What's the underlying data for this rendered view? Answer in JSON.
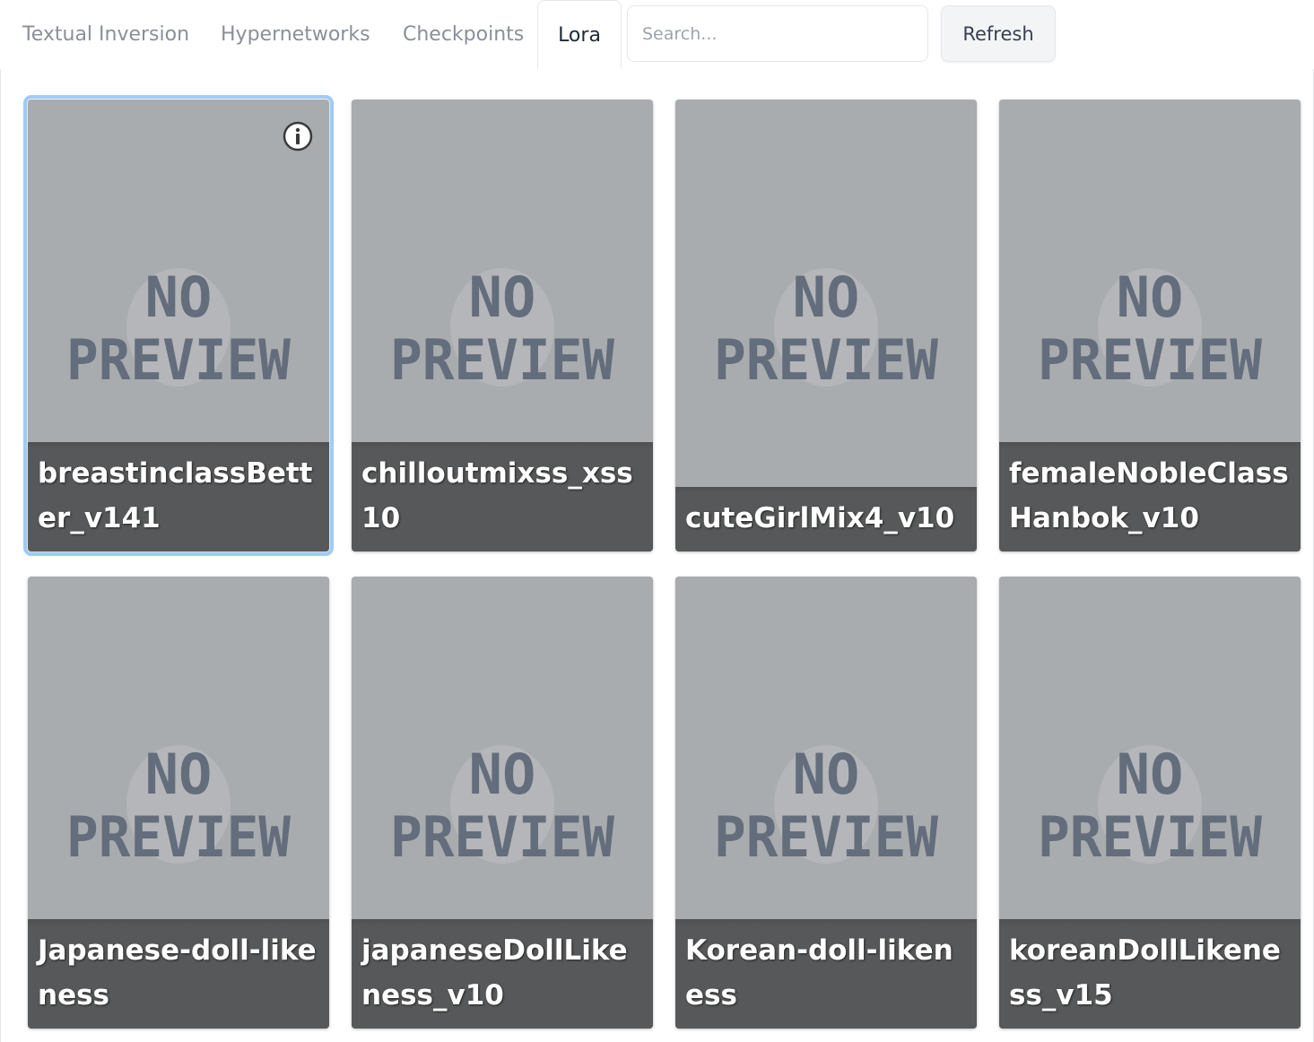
{
  "tabs": [
    {
      "label": "Textual Inversion",
      "active": false
    },
    {
      "label": "Hypernetworks",
      "active": false
    },
    {
      "label": "Checkpoints",
      "active": false
    },
    {
      "label": "Lora",
      "active": true
    }
  ],
  "search": {
    "placeholder": "Search...",
    "value": ""
  },
  "refresh_label": "Refresh",
  "preview_text": {
    "line1": "NO",
    "line2": "PREVIEW"
  },
  "cards": [
    {
      "name": "breastinclassBetter_v141",
      "selected": true
    },
    {
      "name": "chilloutmixss_xss10",
      "selected": false
    },
    {
      "name": "cuteGirlMix4_v10",
      "selected": false
    },
    {
      "name": "femaleNobleClassHanbok_v10",
      "selected": false
    },
    {
      "name": "Japanese-doll-likeness",
      "selected": false
    },
    {
      "name": "japaneseDollLikeness_v10",
      "selected": false
    },
    {
      "name": "Korean-doll-likeness",
      "selected": false
    },
    {
      "name": "koreanDollLikeness_v15",
      "selected": false
    }
  ]
}
